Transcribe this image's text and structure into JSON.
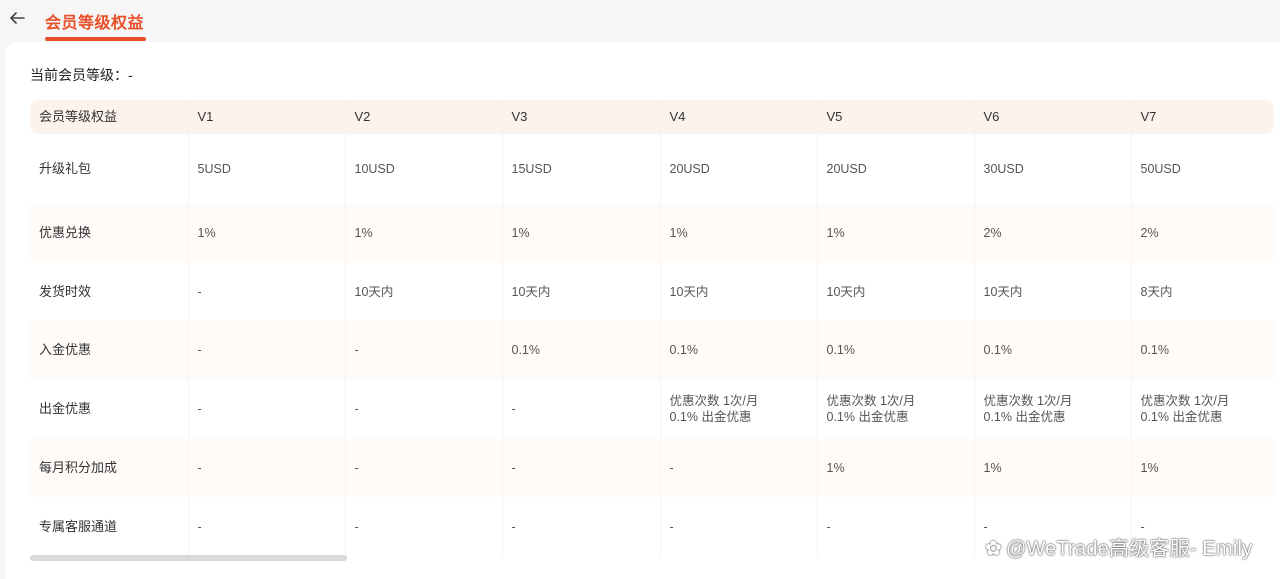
{
  "header": {
    "title": "会员等级权益"
  },
  "current_level": "当前会员等级：-",
  "table": {
    "headers": [
      "会员等级权益",
      "V1",
      "V2",
      "V3",
      "V4",
      "V5",
      "V6",
      "V7"
    ],
    "rows": [
      {
        "label": "升级礼包",
        "cells": [
          "5USD",
          "10USD",
          "15USD",
          "20USD",
          "20USD",
          "30USD",
          "50USD"
        ]
      },
      {
        "label": "优惠兑换",
        "cells": [
          "1%",
          "1%",
          "1%",
          "1%",
          "1%",
          "2%",
          "2%"
        ]
      },
      {
        "label": "发货时效",
        "cells": [
          "-",
          "10天内",
          "10天内",
          "10天内",
          "10天内",
          "10天内",
          "8天内"
        ]
      },
      {
        "label": "入金优惠",
        "cells": [
          "-",
          "-",
          "0.1%",
          "0.1%",
          "0.1%",
          "0.1%",
          "0.1%"
        ]
      },
      {
        "label": "出金优惠",
        "cells": [
          "-",
          "-",
          "-",
          "优惠次数 1次/月",
          "优惠次数 1次/月",
          "优惠次数 1次/月",
          "优惠次数 1次/月"
        ],
        "cells_line2": [
          "",
          "",
          "",
          "0.1% 出金优惠",
          "0.1% 出金优惠",
          "0.1% 出金优惠",
          "0.1% 出金优惠"
        ]
      },
      {
        "label": "每月积分加成",
        "cells": [
          "-",
          "-",
          "-",
          "-",
          "1%",
          "1%",
          "1%"
        ]
      },
      {
        "label": "专属客服通道",
        "cells": [
          "-",
          "-",
          "-",
          "-",
          "-",
          "-",
          "-"
        ]
      }
    ]
  },
  "watermark": "@WeTrade高级客服- Emily",
  "colors": {
    "accent": "#e8502a",
    "header_bg": "#fdf3ed"
  }
}
